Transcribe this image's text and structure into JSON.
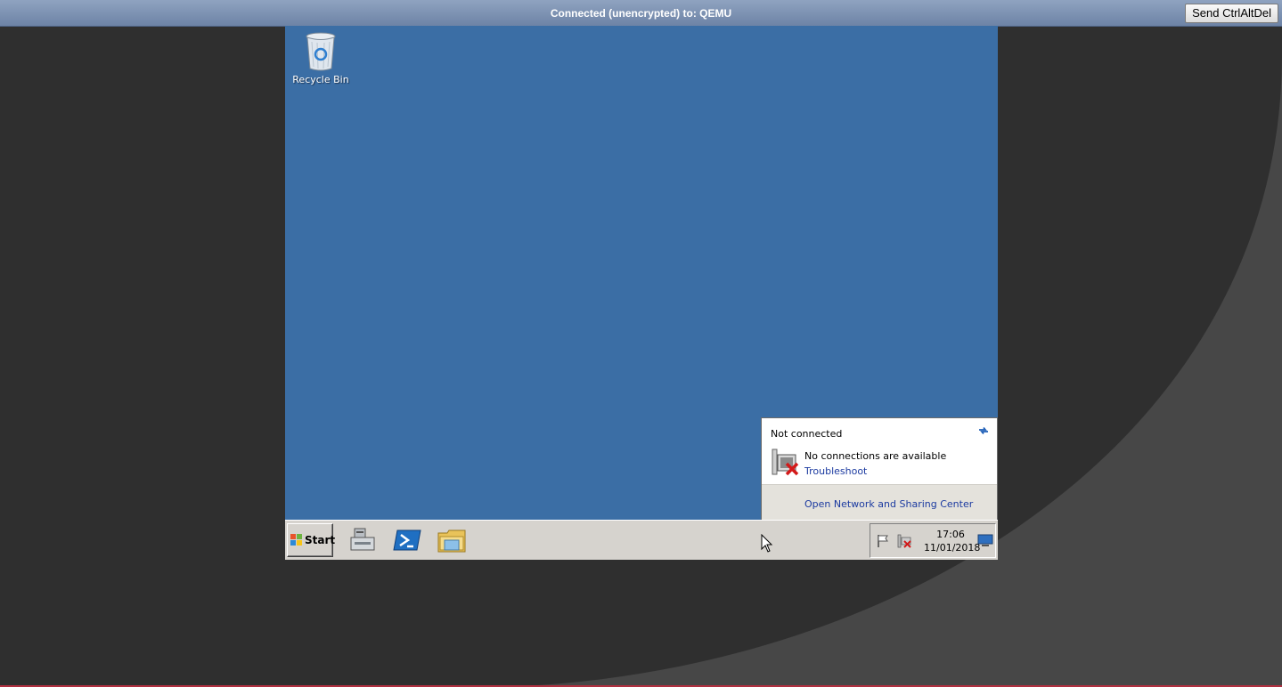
{
  "vnc": {
    "status": "Connected (unencrypted) to: QEMU",
    "ctrl_alt_del_label": "Send CtrlAltDel"
  },
  "desktop": {
    "background_color": "#3b6ea5",
    "icons": [
      {
        "label": "Recycle Bin",
        "icon": "recycle-bin-icon"
      }
    ]
  },
  "network_flyout": {
    "title": "Not connected",
    "message": "No connections are available",
    "troubleshoot_link": "Troubleshoot",
    "sharing_center_link": "Open Network and Sharing Center",
    "link_color": "#1b3aa0"
  },
  "taskbar": {
    "start_label": "Start",
    "pinned_apps": [
      "server-manager-icon",
      "powershell-icon",
      "file-explorer-icon"
    ],
    "tray_icons": [
      "action-center-flag-icon",
      "network-disconnected-icon"
    ],
    "clock": {
      "time": "17:06",
      "date": "11/01/2018"
    }
  }
}
